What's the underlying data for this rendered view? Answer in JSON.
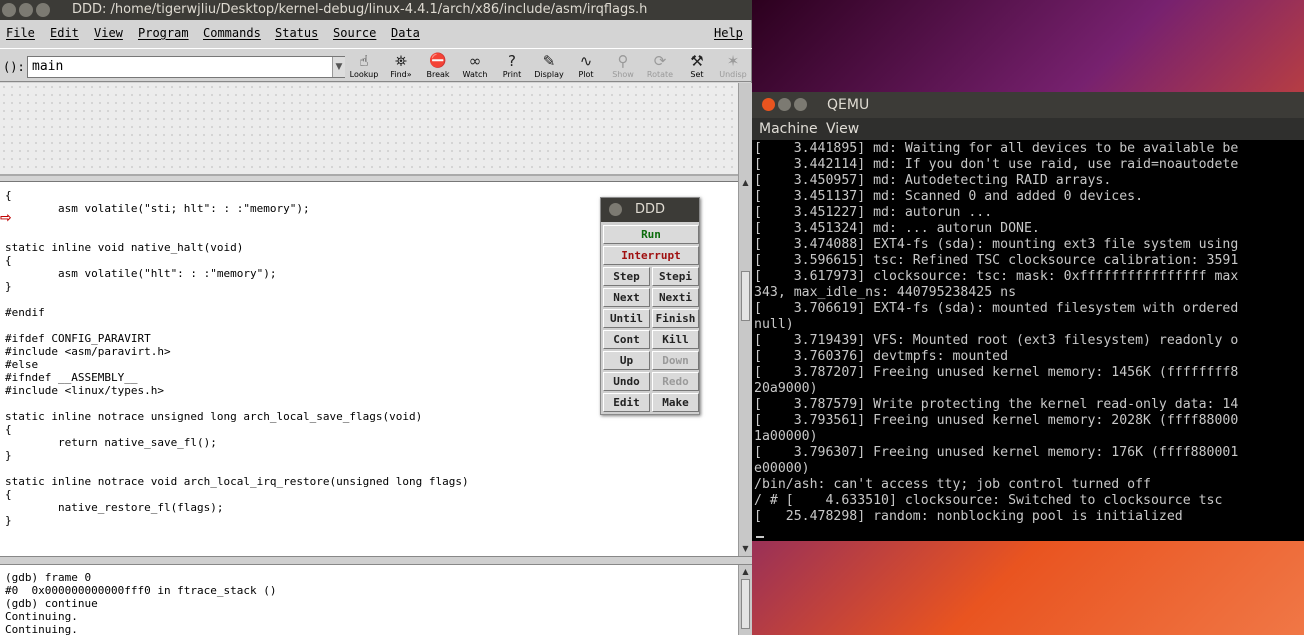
{
  "ddd": {
    "title": "DDD: /home/tigerwjliu/Desktop/kernel-debug/linux-4.4.1/arch/x86/include/asm/irqflags.h",
    "menu": [
      "File",
      "Edit",
      "View",
      "Program",
      "Commands",
      "Status",
      "Source",
      "Data"
    ],
    "help": "Help",
    "arg_label": "():",
    "arg_value": "main",
    "tools": [
      {
        "label": "Lookup",
        "icon": "lookup-icon",
        "enabled": true
      },
      {
        "label": "Find»",
        "icon": "find-icon",
        "enabled": true
      },
      {
        "label": "Break",
        "icon": "break-stop-icon",
        "enabled": true
      },
      {
        "label": "Watch",
        "icon": "watch-glasses-icon",
        "enabled": true
      },
      {
        "label": "Print",
        "icon": "print-question-icon",
        "enabled": true
      },
      {
        "label": "Display",
        "icon": "display-icon",
        "enabled": true
      },
      {
        "label": "Plot",
        "icon": "plot-icon",
        "enabled": true
      },
      {
        "label": "Show",
        "icon": "show-magnifier-icon",
        "enabled": false
      },
      {
        "label": "Rotate",
        "icon": "rotate-icon",
        "enabled": false
      },
      {
        "label": "Set",
        "icon": "set-icon",
        "enabled": true
      },
      {
        "label": "Undisp",
        "icon": "undisp-icon",
        "enabled": false
      }
    ],
    "source_lines": [
      "{",
      "        asm volatile(\"sti; hlt\": : :\"memory\");",
      "",
      "static inline void native_halt(void)",
      "{",
      "        asm volatile(\"hlt\": : :\"memory\");",
      "}",
      "",
      "#endif",
      "",
      "#ifdef CONFIG_PARAVIRT",
      "#include <asm/paravirt.h>",
      "#else",
      "#ifndef __ASSEMBLY__",
      "#include <linux/types.h>",
      "",
      "static inline notrace unsigned long arch_local_save_flags(void)",
      "{",
      "        return native_save_fl();",
      "}",
      "",
      "static inline notrace void arch_local_irq_restore(unsigned long flags)",
      "{",
      "        native_restore_fl(flags);",
      "}"
    ],
    "gdb_lines": [
      "(gdb) frame 0",
      "#0  0x000000000000fff0 in ftrace_stack ()",
      "(gdb) continue",
      "Continuing.",
      "Continuing."
    ]
  },
  "command_tool": {
    "title": "DDD",
    "buttons": [
      {
        "label": "Run",
        "color": "#0b6b0b",
        "enabled": true
      },
      {
        "label": "Interrupt",
        "color": "#a01010",
        "enabled": true
      },
      {
        "label": "Step",
        "enabled": true
      },
      {
        "label": "Stepi",
        "enabled": true
      },
      {
        "label": "Next",
        "enabled": true
      },
      {
        "label": "Nexti",
        "enabled": true
      },
      {
        "label": "Until",
        "enabled": true
      },
      {
        "label": "Finish",
        "enabled": true
      },
      {
        "label": "Cont",
        "enabled": true
      },
      {
        "label": "Kill",
        "enabled": true
      },
      {
        "label": "Up",
        "enabled": true
      },
      {
        "label": "Down",
        "enabled": false
      },
      {
        "label": "Undo",
        "enabled": true
      },
      {
        "label": "Redo",
        "enabled": false
      },
      {
        "label": "Edit",
        "enabled": true
      },
      {
        "label": "Make",
        "enabled": true
      }
    ]
  },
  "qemu": {
    "title": "QEMU",
    "menu": [
      "Machine",
      "View"
    ],
    "console_lines": [
      "[    3.441895] md: Waiting for all devices to be available be",
      "[    3.442114] md: If you don't use raid, use raid=noautodete",
      "[    3.450957] md: Autodetecting RAID arrays.",
      "[    3.451137] md: Scanned 0 and added 0 devices.",
      "[    3.451227] md: autorun ...",
      "[    3.451324] md: ... autorun DONE.",
      "[    3.474088] EXT4-fs (sda): mounting ext3 file system using",
      "[    3.596615] tsc: Refined TSC clocksource calibration: 3591",
      "[    3.617973] clocksource: tsc: mask: 0xffffffffffffffff max",
      "343, max_idle_ns: 440795238425 ns",
      "[    3.706619] EXT4-fs (sda): mounted filesystem with ordered",
      "null)",
      "[    3.719439] VFS: Mounted root (ext3 filesystem) readonly o",
      "[    3.760376] devtmpfs: mounted",
      "[    3.787207] Freeing unused kernel memory: 1456K (ffffffff8",
      "20a9000)",
      "[    3.787579] Write protecting the kernel read-only data: 14",
      "[    3.793561] Freeing unused kernel memory: 2028K (ffff88000",
      "1a00000)",
      "[    3.796307] Freeing unused kernel memory: 176K (ffff880001",
      "e00000)",
      "/bin/ash: can't access tty; job control turned off",
      "/ # [    4.633510] clocksource: Switched to clocksource tsc",
      "[   25.478298] random: nonblocking pool is initialized"
    ]
  }
}
